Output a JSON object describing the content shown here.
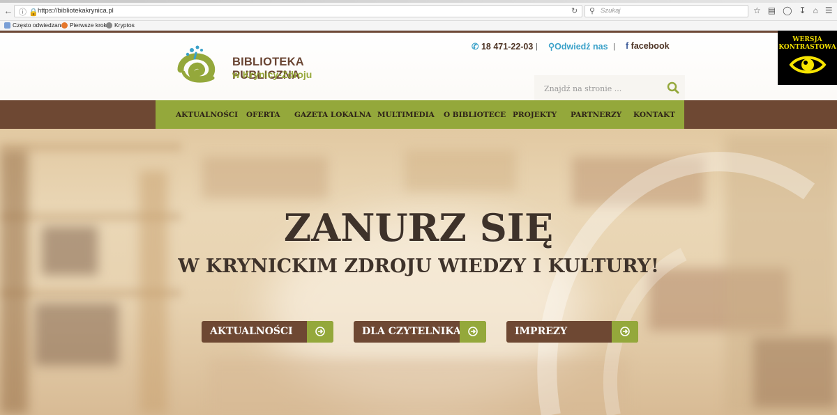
{
  "browser": {
    "url": "https://bibliotekakrynica.pl",
    "search_placeholder": "Szukaj",
    "bookmarks": [
      "Często odwiedzane",
      "Pierwsze kroki",
      "Kryptos"
    ]
  },
  "header": {
    "logo_title": "BIBLIOTEKA PUBLICZNA",
    "logo_subtitle": "w Krynicy-Zdroju",
    "phone": "18 471-22-03",
    "visit": "Odwiedź nas",
    "facebook": "facebook",
    "separator": "|",
    "search_placeholder": "Znajdź na stronie ...",
    "contrast_label_line1": "WERSJA",
    "contrast_label_line2": "KONTRASTOWA"
  },
  "nav": {
    "items": [
      "AKTUALNOŚCI",
      "OFERTA",
      "GAZETA LOKALNA",
      "MULTIMEDIA",
      "O BIBLIOTECE",
      "PROJEKTY",
      "PARTNERZY",
      "KONTAKT"
    ]
  },
  "hero": {
    "title": "ZANURZ SIĘ",
    "subtitle": "W KRYNICKIM ZDROJU WIEDZY I KULTURY!",
    "buttons": [
      "AKTUALNOŚCI",
      "DLA CZYTELNIKA",
      "IMPREZY"
    ]
  },
  "colors": {
    "brown": "#6e4833",
    "green": "#94a83b",
    "blue": "#3aa1c9",
    "contrast_yellow": "#f7e400"
  }
}
